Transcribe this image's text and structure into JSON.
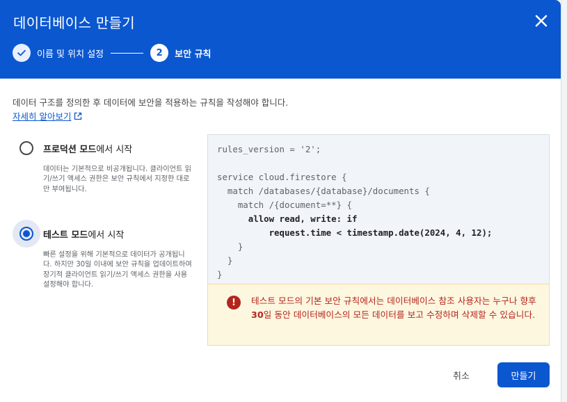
{
  "dialog": {
    "title": "데이터베이스 만들기",
    "close_icon": "close-icon"
  },
  "stepper": {
    "steps": [
      {
        "label": "이름 및 위치 설정",
        "state": "completed",
        "icon": "check-icon"
      },
      {
        "number": "2",
        "label": "보안 규칙",
        "state": "active"
      }
    ]
  },
  "intro": {
    "text": "데이터 구조를 정의한 후 데이터에 보안을 적용하는 규칙을 작성해야 합니다.",
    "learn_more": "자세히 알아보기",
    "learn_more_icon": "open-in-new-icon"
  },
  "options": [
    {
      "title_bold": "프로덕션 모드",
      "title_rest": "에서 시작",
      "description": "데이터는 기본적으로 비공개됩니다. 클라이언트 읽기/쓰기 액세스 권한은 보안 규칙에서 지정한 대로만 부여됩니다.",
      "selected": false
    },
    {
      "title_bold": "테스트 모드",
      "title_rest": "에서 시작",
      "description": "빠른 설정을 위해 기본적으로 데이터가 공개됩니다. 하지만 30일 이내에 보안 규칙을 업데이트하여 장기적 클라이언트 읽기/쓰기 액세스 권한을 사용 설정해야 합니다.",
      "selected": true
    }
  ],
  "rules": {
    "lines": [
      "rules_version = '2';",
      "",
      "service cloud.firestore {",
      "  match /databases/{database}/documents {",
      "    match /{document=**} {",
      "      allow read, write: if",
      "          request.time < timestamp.date(2024, 4, 12);",
      "    }",
      "  }",
      "}"
    ],
    "bold_lines": [
      5,
      6
    ]
  },
  "warning": {
    "icon": "error-icon",
    "text_before": "테스트 모드의 기본 보안 규칙에서는 데이터베이스 참조 사용자는 누구나 향후 ",
    "text_bold": "30",
    "text_after": "일 동안 데이터베이스의 모든 데이터를 보고 수정하며 삭제할 수 있습니다."
  },
  "actions": {
    "cancel": "취소",
    "create": "만들기"
  },
  "colors": {
    "primary": "#0b57d0",
    "warning_bg": "#fef7e0",
    "warning_text": "#b3261e"
  }
}
